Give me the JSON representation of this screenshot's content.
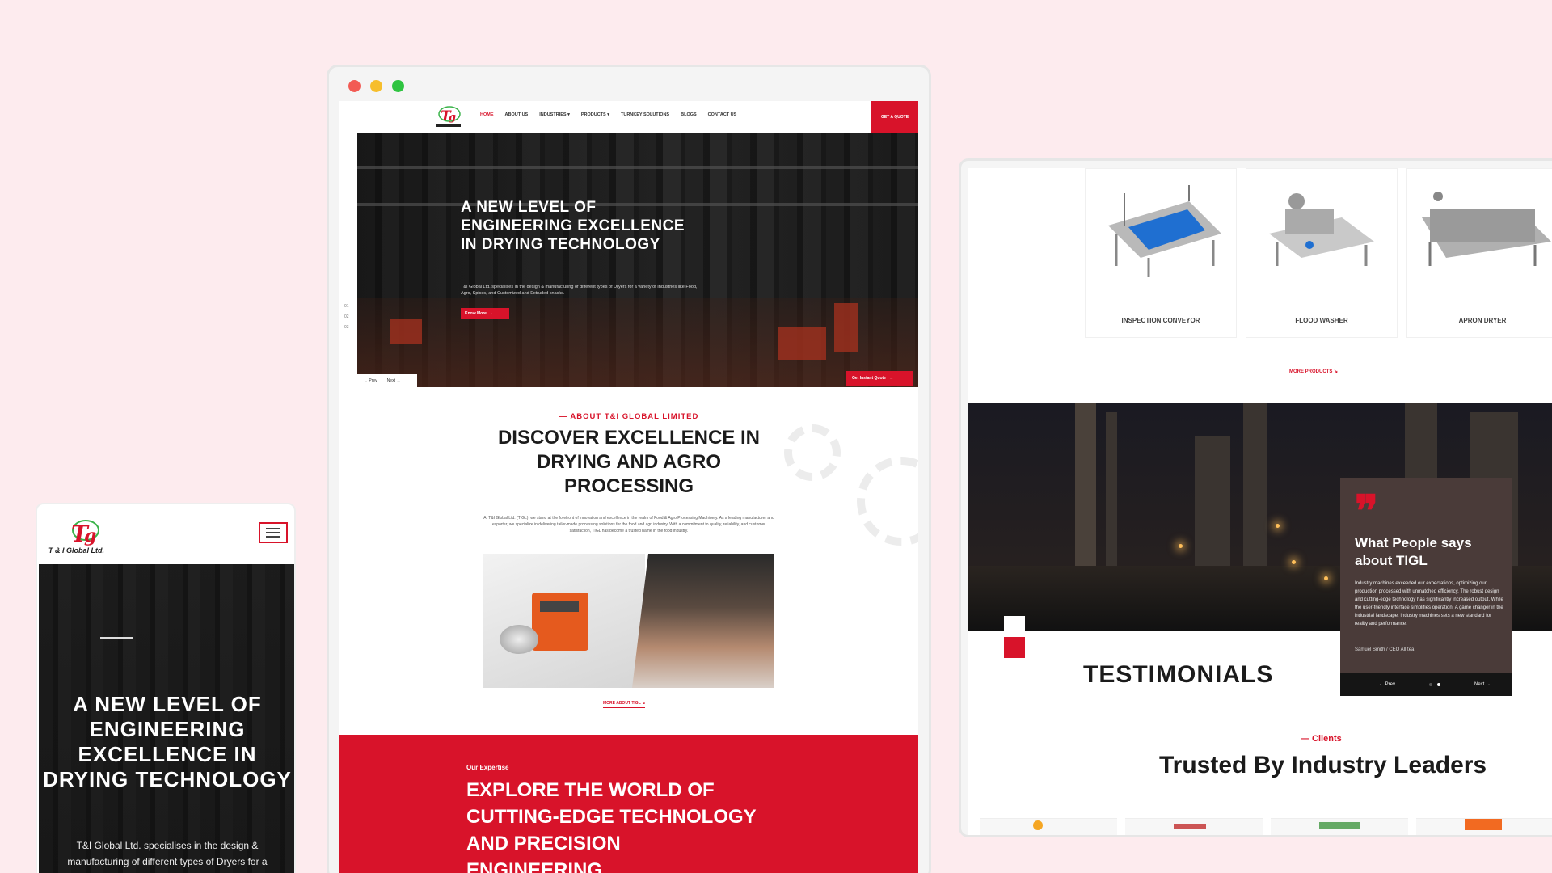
{
  "desktop": {
    "window_dots": [
      "#f25b54",
      "#f6be2c",
      "#2fc441"
    ],
    "nav": {
      "links": [
        "HOME",
        "ABOUT US",
        "INDUSTRIES ▾",
        "PRODUCTS ▾",
        "TURNKEY SOLUTIONS",
        "BLOGS",
        "CONTACT US"
      ],
      "cta": "GET A QUOTE"
    },
    "hero": {
      "title": "A NEW LEVEL OF ENGINEERING EXCELLENCE IN DRYING TECHNOLOGY",
      "description": "T&I Global Ltd. specialises in the design & manufacturing of different types of Dryers for a variety of Industries like Food, Agro, Spices, and Customized and Extruded snacks.",
      "button": "Know More",
      "prev": "← Prev",
      "next": "Next →",
      "instant_quote": "Get Instant Quote",
      "slide_indices": [
        "01",
        "02",
        "03"
      ]
    },
    "about": {
      "eyebrow": "— ABOUT T&I GLOBAL LIMITED",
      "title": "DISCOVER EXCELLENCE IN DRYING AND AGRO PROCESSING",
      "body": "At T&I Global Ltd. (TIGL), we stand at the forefront of innovation and excellence in the realm of Food & Agro Processing Machinery. As a leading manufacturer and exporter, we specialize in delivering tailor-made processing solutions for the food and agri industry. With a commitment to quality, reliability, and customer satisfaction, TIGL has become a trusted name in the food industry.",
      "more_link": "MORE ABOUT TIGL ↘"
    },
    "expertise": {
      "label": "Our Expertise",
      "title": "EXPLORE THE WORLD OF CUTTING-EDGE TECHNOLOGY AND PRECISION ENGINEERING."
    }
  },
  "mobile": {
    "brand": "T & I Global Ltd.",
    "hero_title": "A NEW LEVEL OF ENGINEERING EXCELLENCE IN DRYING TECHNOLOGY",
    "hero_text": "T&I Global Ltd. specialises in the design & manufacturing of different types of Dryers for a variety of Industries like Food, Agro, Spices, and"
  },
  "products_page": {
    "products": [
      {
        "name": "INSPECTION CONVEYOR"
      },
      {
        "name": "FLOOD WASHER"
      },
      {
        "name": "APRON DRYER"
      }
    ],
    "more_products": "MORE PRODUCTS ↘",
    "testimonials_title": "TESTIMONIALS",
    "testimonial": {
      "quote_mark": "❞",
      "heading": "What People says about TIGL",
      "text": "Industry machines exceeded our expectations, optimizing our production processed with unmatched efficiency. The robust design and cutting-edge technology has significantly increased output. While the user-friendly interface simplifies operation. A game changer in the industrial landscape. Industry machines sets a new standard for reality and performance.",
      "author": "Samuel Smith / CEO All tea",
      "prev": "← Prev",
      "next": "Next →"
    },
    "clients_label": "— Clients",
    "clients_title": "Trusted By Industry Leaders"
  },
  "colors": {
    "brand_red": "#d8132a",
    "background": "#fdebee"
  }
}
